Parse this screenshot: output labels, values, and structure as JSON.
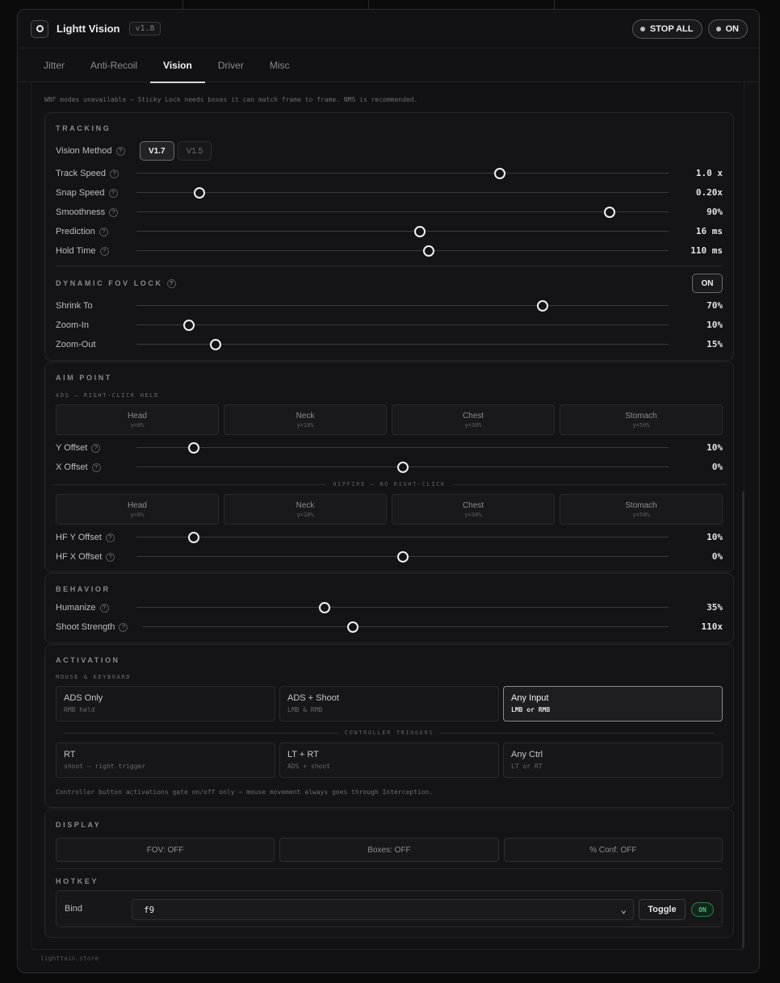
{
  "app": {
    "title": "Lightt Vision",
    "version": "v1.8",
    "stop_all_label": "STOP ALL",
    "power_label": "ON"
  },
  "tabs": [
    {
      "label": "Jitter",
      "active": false
    },
    {
      "label": "Anti-Recoil",
      "active": false
    },
    {
      "label": "Vision",
      "active": true
    },
    {
      "label": "Driver",
      "active": false
    },
    {
      "label": "Misc",
      "active": false
    }
  ],
  "notice": "WBF modes unavailable — Sticky Lock needs boxes it can match frame to frame. NMS is recommended.",
  "help_glyph": "?",
  "tracking": {
    "title": "TRACKING",
    "method_label": "Vision Method",
    "methods": [
      {
        "label": "V1.7",
        "active": true
      },
      {
        "label": "V1.5",
        "active": false
      }
    ],
    "sliders": [
      {
        "label": "Track Speed",
        "value": "1.0 x",
        "fraction": 0.683
      },
      {
        "label": "Snap Speed",
        "value": "0.20x",
        "fraction": 0.118
      },
      {
        "label": "Smoothness",
        "value": "90%",
        "fraction": 0.889
      },
      {
        "label": "Prediction",
        "value": "16 ms",
        "fraction": 0.532
      },
      {
        "label": "Hold Time",
        "value": "110 ms",
        "fraction": 0.55
      }
    ],
    "dynamic_fov": {
      "title": "DYNAMIC FOV LOCK",
      "toggle_label": "ON",
      "sliders": [
        {
          "label": "Shrink To",
          "value": "70%",
          "fraction": 0.763
        },
        {
          "label": "Zoom-In",
          "value": "10%",
          "fraction": 0.099
        },
        {
          "label": "Zoom-Out",
          "value": "15%",
          "fraction": 0.149
        }
      ]
    }
  },
  "aim_point": {
    "title": "AIM POINT",
    "ads_subtitle": "ADS — RIGHT-CLICK HELD",
    "ads_presets": [
      {
        "name": "Head",
        "value": "y=8%"
      },
      {
        "name": "Neck",
        "value": "y=18%"
      },
      {
        "name": "Chest",
        "value": "y=30%"
      },
      {
        "name": "Stomach",
        "value": "y=50%"
      }
    ],
    "ads_sliders": [
      {
        "label": "Y Offset",
        "value": "10%",
        "fraction": 0.108
      },
      {
        "label": "X Offset",
        "value": "0%",
        "fraction": 0.5
      }
    ],
    "hipfire_subtitle": "HIPFIRE — NO RIGHT-CLICK",
    "hipfire_presets": [
      {
        "name": "Head",
        "value": "y=8%"
      },
      {
        "name": "Neck",
        "value": "y=18%"
      },
      {
        "name": "Chest",
        "value": "y=30%"
      },
      {
        "name": "Stomach",
        "value": "y=50%"
      }
    ],
    "hipfire_sliders": [
      {
        "label": "HF Y Offset",
        "value": "10%",
        "fraction": 0.108
      },
      {
        "label": "HF X Offset",
        "value": "0%",
        "fraction": 0.5
      }
    ]
  },
  "behavior": {
    "title": "BEHAVIOR",
    "sliders": [
      {
        "label": "Humanize",
        "value": "35%",
        "fraction": 0.353
      },
      {
        "label": "Shoot Strength",
        "value": "110x",
        "fraction": 0.4
      }
    ]
  },
  "activation": {
    "title": "ACTIVATION",
    "mk_subtitle": "MOUSE & KEYBOARD",
    "mk_options": [
      {
        "name": "ADS Only",
        "desc": "RMB held",
        "active": false
      },
      {
        "name": "ADS + Shoot",
        "desc": "LMB & RMB",
        "active": false
      },
      {
        "name": "Any Input",
        "desc": "LMB or RMB",
        "active": true
      }
    ],
    "ctrl_subtitle": "CONTROLLER TRIGGERS",
    "ctrl_options": [
      {
        "name": "RT",
        "desc": "shoot — right trigger"
      },
      {
        "name": "LT + RT",
        "desc": "ADS + shoot"
      },
      {
        "name": "Any Ctrl",
        "desc": "LT or RT"
      }
    ],
    "note": "Controller button activations gate on/off only — mouse movement always goes through Interception."
  },
  "display": {
    "title": "DISPLAY",
    "buttons": [
      "FOV: OFF",
      "Boxes: OFF",
      "% Conf: OFF"
    ],
    "hotkey_title": "HOTKEY",
    "bind_label": "Bind",
    "bind_value": "f9",
    "toggle_label": "Toggle",
    "status_label": "ON"
  },
  "footer": "lighttain.store"
}
